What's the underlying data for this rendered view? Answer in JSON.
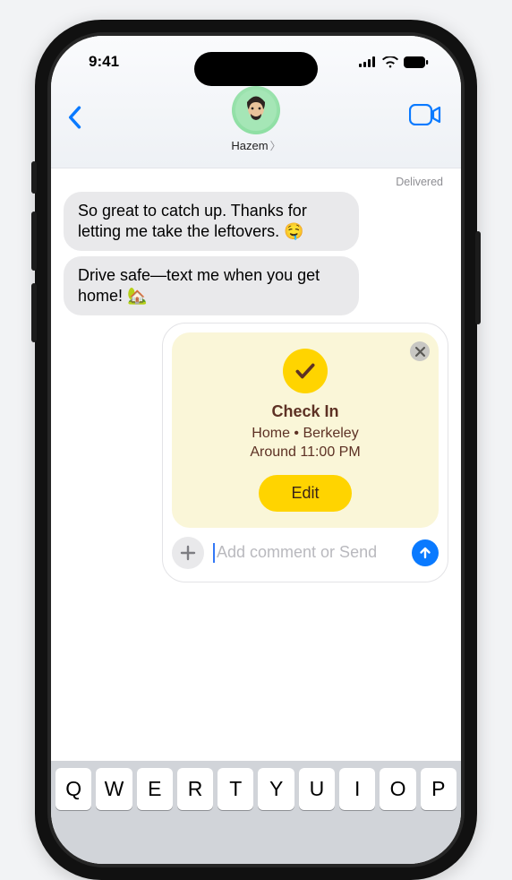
{
  "status": {
    "time": "9:41"
  },
  "header": {
    "contact_name": "Hazem"
  },
  "thread": {
    "delivered_label": "Delivered",
    "messages": [
      "So great to catch up. Thanks for letting me take the leftovers. 🤤",
      "Drive safe—text me when you get home! 🏡"
    ]
  },
  "checkin": {
    "title": "Check In",
    "line1": "Home  •  Berkeley",
    "line2": "Around 11:00 PM",
    "edit_label": "Edit"
  },
  "compose": {
    "placeholder": "Add comment or Send"
  },
  "keyboard": {
    "row1": [
      "Q",
      "W",
      "E",
      "R",
      "T",
      "Y",
      "U",
      "I",
      "O",
      "P"
    ]
  }
}
